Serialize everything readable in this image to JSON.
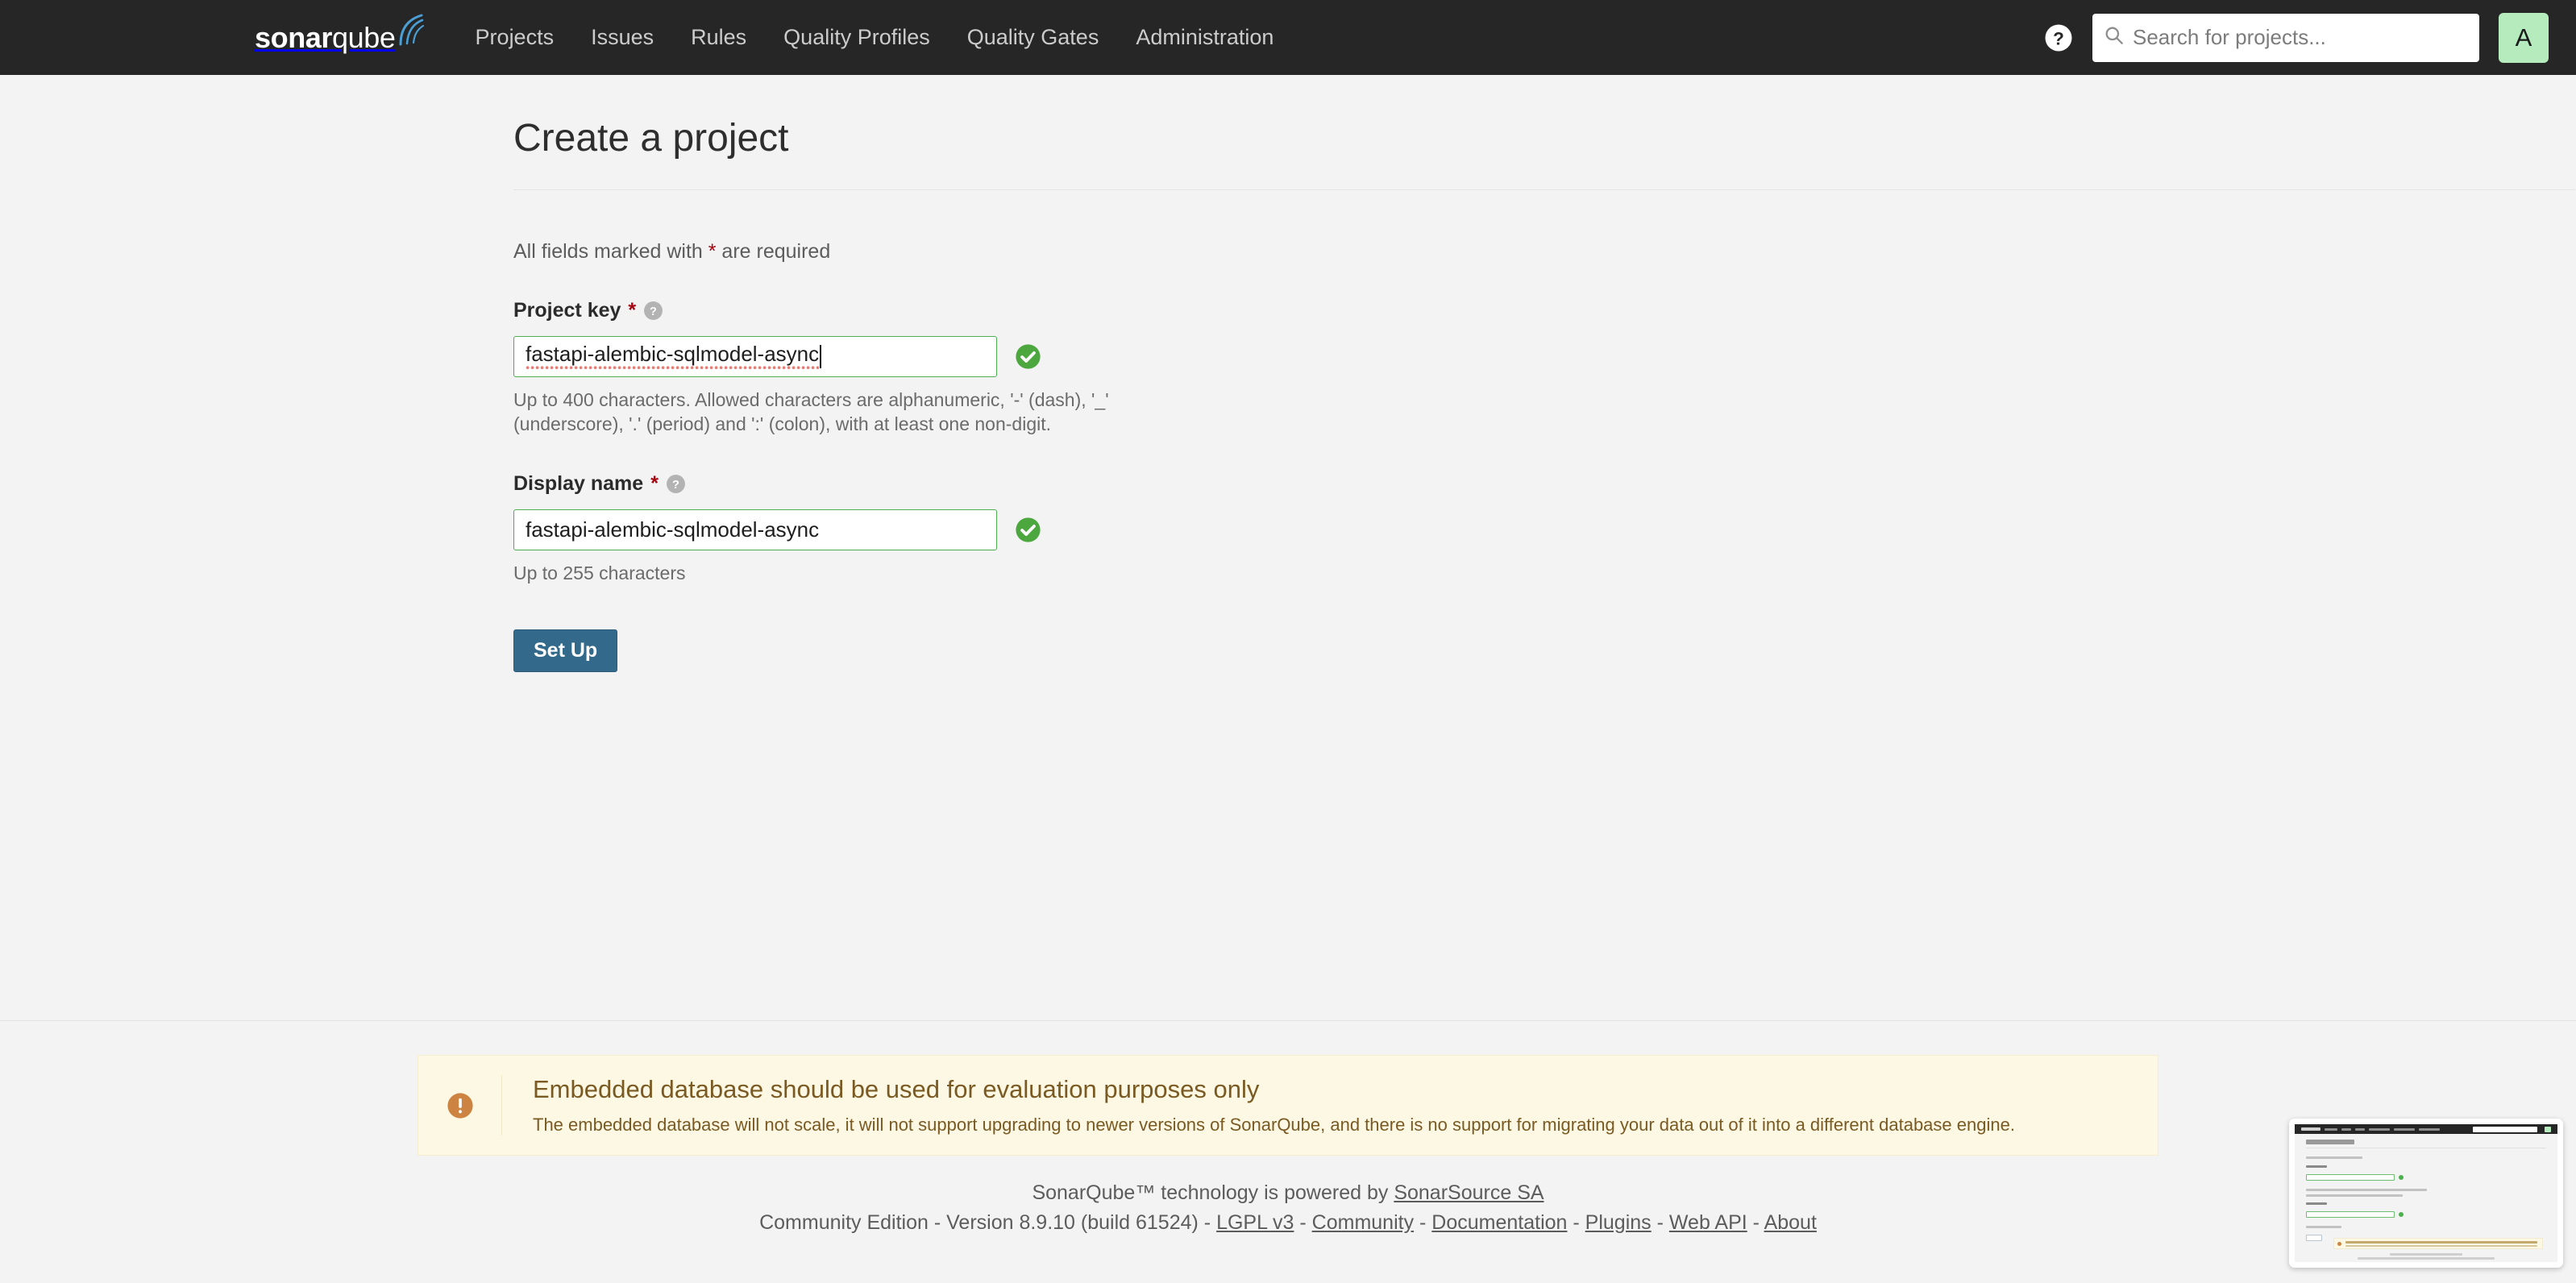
{
  "navbar": {
    "logo": {
      "bold_part": "sonar",
      "light_part": "qube",
      "name": "sonarqube"
    },
    "links": [
      {
        "label": "Projects",
        "name": "nav-link-projects"
      },
      {
        "label": "Issues",
        "name": "nav-link-issues"
      },
      {
        "label": "Rules",
        "name": "nav-link-rules"
      },
      {
        "label": "Quality Profiles",
        "name": "nav-link-quality-profiles"
      },
      {
        "label": "Quality Gates",
        "name": "nav-link-quality-gates"
      },
      {
        "label": "Administration",
        "name": "nav-link-administration"
      }
    ],
    "help_icon": "help-circle-icon",
    "search": {
      "placeholder": "Search for projects...",
      "value": "",
      "icon": "search-icon"
    },
    "avatar": {
      "initial": "A",
      "background": "#b5ebbd"
    }
  },
  "page": {
    "title": "Create a project",
    "required_note_prefix": "All fields marked with ",
    "required_star": "*",
    "required_note_suffix": " are required"
  },
  "form": {
    "project_key": {
      "label": "Project key",
      "required_star": "*",
      "help_icon": "help-circle-icon",
      "value": "fastapi-alembic-sqlmodel-async",
      "placeholder": "",
      "valid_icon": "check-circle-icon",
      "helper": "Up to 400 characters. Allowed characters are alphanumeric, '-' (dash), '_' (underscore), '.' (period) and ':' (colon), with at least one non-digit.",
      "state": "valid",
      "focused": true
    },
    "display_name": {
      "label": "Display name",
      "required_star": "*",
      "help_icon": "help-circle-icon",
      "value": "fastapi-alembic-sqlmodel-async",
      "placeholder": "",
      "valid_icon": "check-circle-icon",
      "helper": "Up to 255 characters",
      "state": "valid",
      "focused": false
    },
    "submit_label": "Set Up"
  },
  "alert": {
    "icon": "warning-circle-icon",
    "title": "Embedded database should be used for evaluation purposes only",
    "text": "The embedded database will not scale, it will not support upgrading to newer versions of SonarQube, and there is no support for migrating your data out of it into a different database engine.",
    "background": "#fcf8e3",
    "accent": "#cd8341"
  },
  "footer": {
    "powered_prefix": "SonarQube™ technology is powered by ",
    "powered_link": "SonarSource SA",
    "edition": "Community Edition",
    "version": "Version 8.9.10 (build 61524)",
    "separator": " - ",
    "links": [
      {
        "label": "LGPL v3"
      },
      {
        "label": "Community"
      },
      {
        "label": "Documentation"
      },
      {
        "label": "Plugins"
      },
      {
        "label": "Web API"
      },
      {
        "label": "About"
      }
    ]
  },
  "thumbnail": {
    "name": "page-preview-thumbnail",
    "caption": ""
  },
  "colors": {
    "navbar_bg": "#262626",
    "page_bg": "#f3f3f3",
    "valid_green": "#4caf50",
    "button_blue": "#336a8c",
    "required_red": "#a4030f",
    "warning_orange": "#cd8341"
  }
}
